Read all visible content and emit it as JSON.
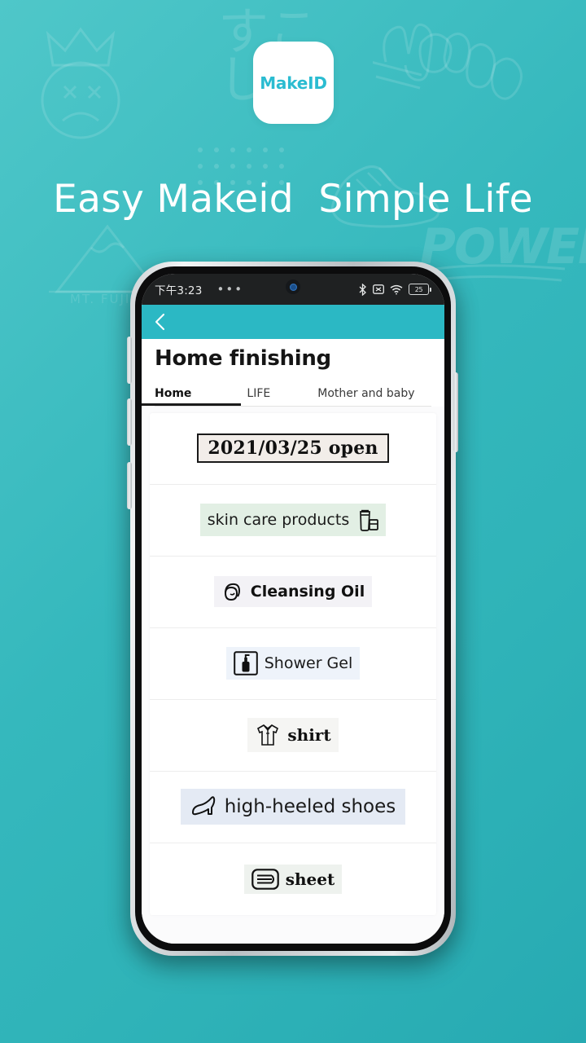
{
  "promo": {
    "app_icon_label": "MakeID",
    "tagline": "Easy Makeid  Simple Life",
    "background_doodles": [
      {
        "name": "crown-sad-face-doodle",
        "text": ""
      },
      {
        "name": "hello-graffiti-doodle",
        "text": "HELLO"
      },
      {
        "name": "japanese-kana-doodle",
        "text": "すこし"
      },
      {
        "name": "mount-fuji-doodle",
        "text": "MT. FUJI"
      },
      {
        "name": "power-graffiti-doodle",
        "text": "POWER"
      },
      {
        "name": "dot-grid-doodle",
        "text": ""
      },
      {
        "name": "sneaker-doodle",
        "text": ""
      }
    ],
    "brand_teal": "#2bb8c4",
    "logo_teal": "#2bbcd1",
    "background_gradient_start": "#4fc7c9",
    "background_gradient_end": "#27aab2"
  },
  "status_bar": {
    "time": "下午3:23",
    "dots": "•••",
    "icons": [
      "bluetooth-icon",
      "no-sim-icon",
      "wifi-icon",
      "battery-icon"
    ],
    "battery_level": "25"
  },
  "app": {
    "back_label": "chevron-left-icon",
    "title": "Home finishing",
    "tabs": [
      {
        "label": "Home",
        "active": true
      },
      {
        "label": "LIFE",
        "active": false
      },
      {
        "label": "Mother and baby",
        "active": false
      }
    ],
    "list": [
      {
        "id": "open-date",
        "text": "2021/03/25 open",
        "icon": "none",
        "chip_bg": "#f2ede9",
        "style": "serif-boxed"
      },
      {
        "id": "skin-care-products",
        "text": "skin care products",
        "icon": "cosmetic-tube-icon",
        "chip_bg": "#e2efe4",
        "style": "sans",
        "icon_side": "right"
      },
      {
        "id": "cleansing-oil",
        "text": "Cleansing Oil",
        "icon": "face-icon",
        "chip_bg": "#f3f2f6",
        "style": "sans-bold",
        "icon_side": "left"
      },
      {
        "id": "shower-gel",
        "text": "Shower Gel",
        "icon": "pump-bottle-icon",
        "chip_bg": "#eef3fa",
        "style": "sans",
        "icon_side": "left"
      },
      {
        "id": "shirt",
        "text": "shirt",
        "icon": "shirt-icon",
        "chip_bg": "#f5f5f3",
        "style": "serif-bold",
        "icon_side": "left"
      },
      {
        "id": "high-heeled-shoes",
        "text": "high-heeled shoes",
        "icon": "high-heel-icon",
        "chip_bg": "#e4eaf4",
        "style": "sans-lg",
        "icon_side": "left"
      },
      {
        "id": "sheet",
        "text": "sheet",
        "icon": "folded-sheet-icon",
        "chip_bg": "#eef2ee",
        "style": "serif-bold",
        "icon_side": "left"
      }
    ]
  }
}
